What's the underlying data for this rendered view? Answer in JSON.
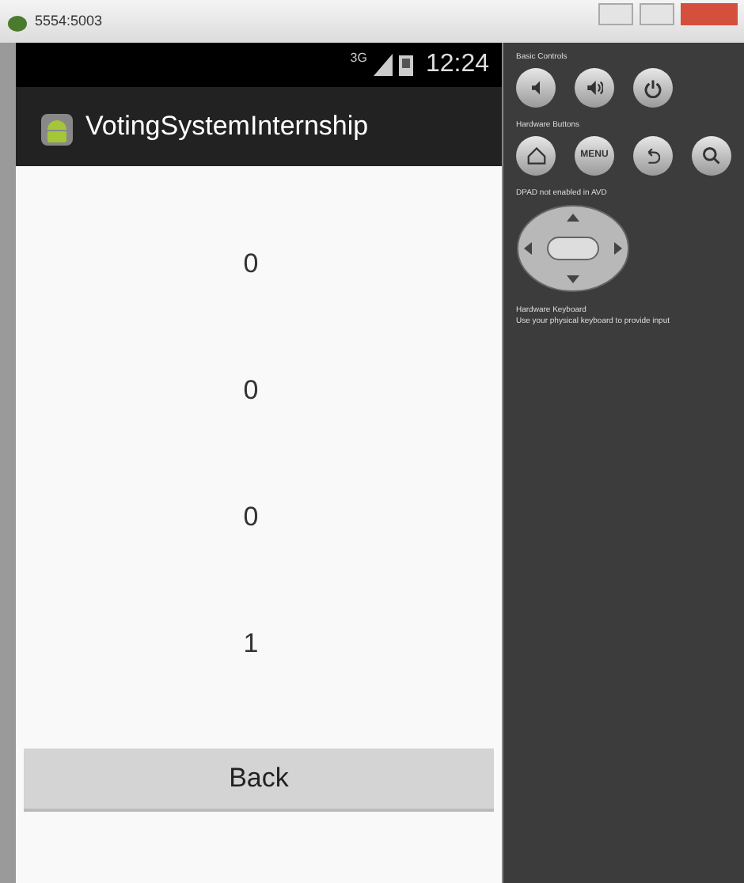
{
  "window": {
    "title": "5554:5003"
  },
  "status_bar": {
    "network": "3G",
    "time": "12:24"
  },
  "action_bar": {
    "title": "VotingSystemInternship"
  },
  "counts": [
    "0",
    "0",
    "0",
    "1"
  ],
  "back_button": {
    "label": "Back"
  },
  "controls_panel": {
    "sections": [
      {
        "heading": "Basic Controls",
        "kind": "buttons",
        "buttons": [
          {
            "kind": "volume_down"
          },
          {
            "kind": "volume_up"
          },
          {
            "kind": "power"
          }
        ]
      },
      {
        "heading": "Hardware Buttons",
        "kind": "buttons",
        "buttons": [
          {
            "kind": "home"
          },
          {
            "kind": "menu",
            "label": "MENU"
          },
          {
            "kind": "back"
          },
          {
            "kind": "search"
          }
        ]
      },
      {
        "heading": "DPAD not enabled in AVD",
        "kind": "dpad"
      },
      {
        "heading": "Hardware Keyboard",
        "kind": "text",
        "text": "Use your physical keyboard to provide input"
      }
    ]
  }
}
